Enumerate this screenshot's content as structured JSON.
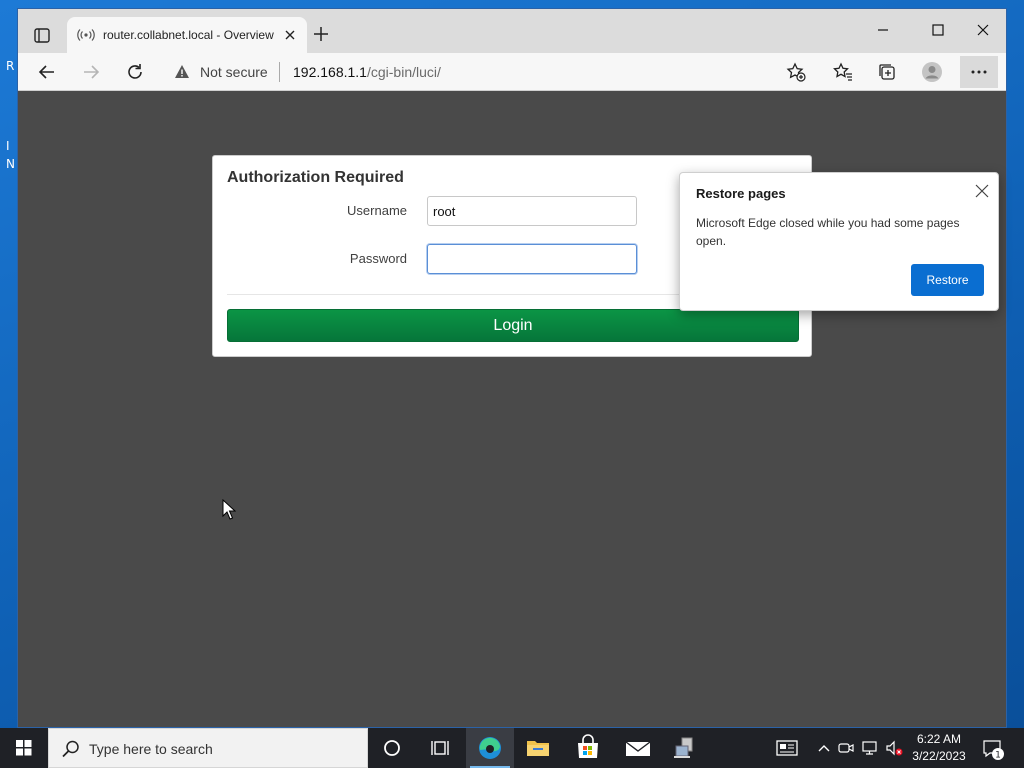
{
  "browser": {
    "tab": {
      "title": "router.collabnet.local - Overview"
    },
    "address": {
      "security_label": "Not secure",
      "url_host": "192.168.1.1",
      "url_path": "/cgi-bin/luci/"
    }
  },
  "login": {
    "title": "Authorization Required",
    "username_label": "Username",
    "username_value": "root",
    "password_label": "Password",
    "password_value": "",
    "login_button": "Login"
  },
  "restore_popup": {
    "title": "Restore pages",
    "message": "Microsoft Edge closed while you had some pages open.",
    "restore_button": "Restore"
  },
  "taskbar": {
    "search_placeholder": "Type here to search",
    "time": "6:22 AM",
    "date": "3/22/2023",
    "notification_count": "1",
    "apps": [
      "cortana-icon",
      "task-view-icon",
      "edge-icon",
      "file-explorer-icon",
      "store-icon",
      "mail-icon",
      "network-app-icon"
    ]
  },
  "desktop": {
    "fragments": [
      "R",
      "I",
      "N"
    ]
  },
  "colors": {
    "login_green": "#06763a",
    "restore_blue": "#0a6ed1",
    "page_bg": "#4a4a4a",
    "taskbar": "#1f2126"
  }
}
